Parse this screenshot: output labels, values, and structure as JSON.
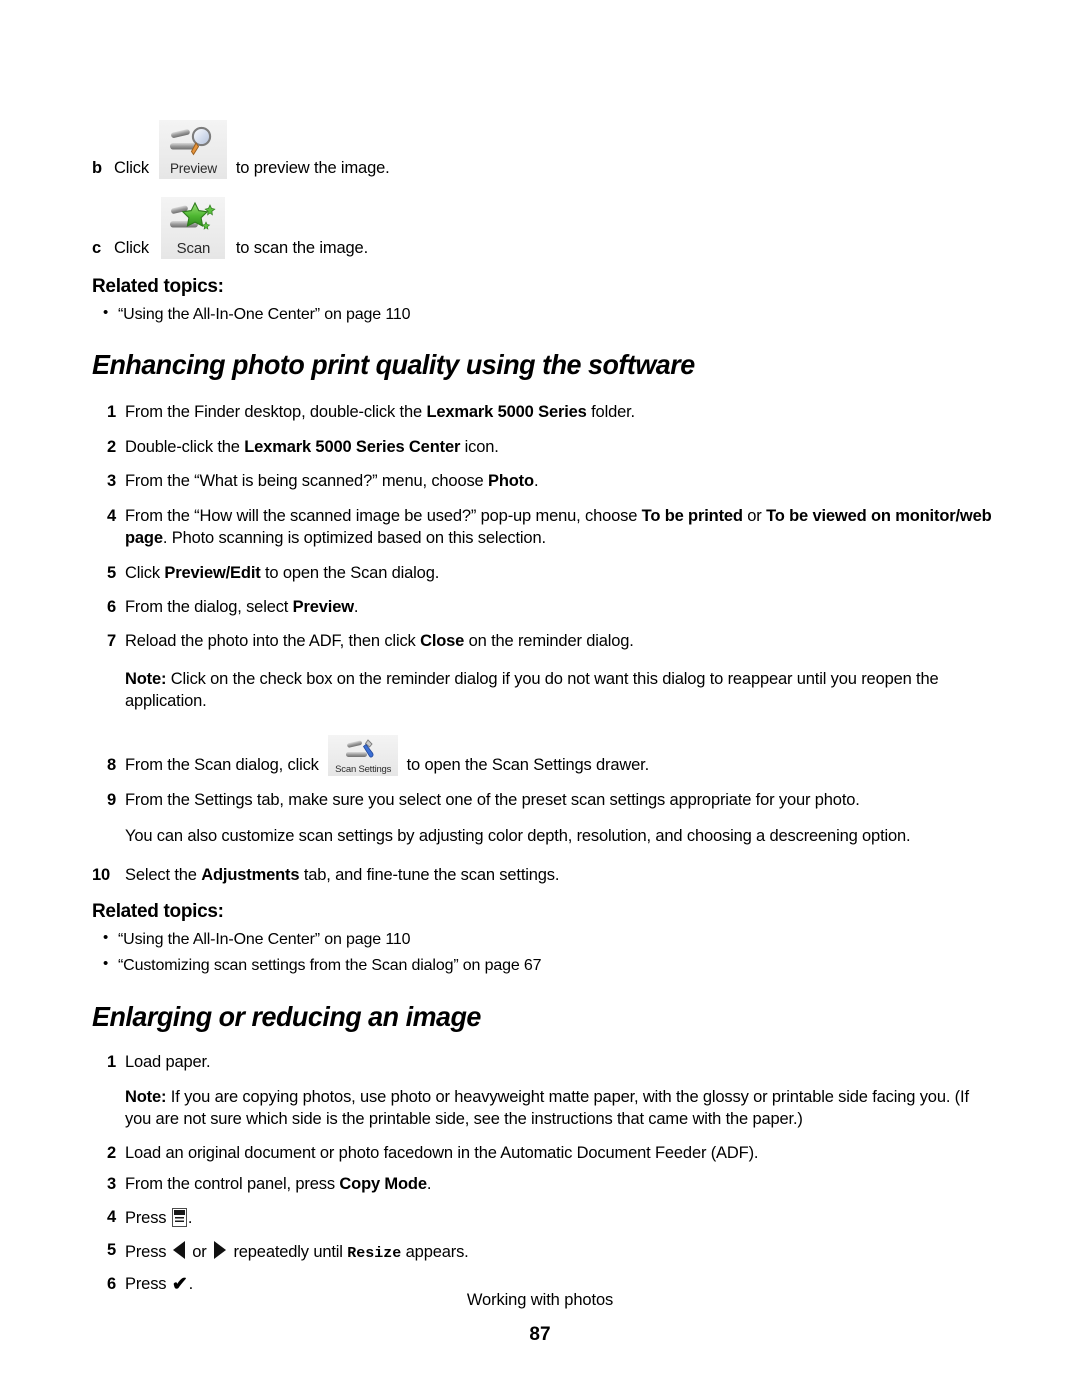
{
  "document": {
    "page_number": "87",
    "footer_title": "Working with photos"
  },
  "substeps": [
    {
      "marker": "b",
      "lead": "Click ",
      "button": "Preview",
      "tail": " to preview the image."
    },
    {
      "marker": "c",
      "lead": "Click ",
      "button": "Scan",
      "tail": " to scan the image."
    }
  ],
  "related_topics_1": {
    "heading": "Related topics:",
    "items": [
      "“Using the All-In-One Center” on page 110"
    ]
  },
  "section_enhancing": {
    "heading": "Enhancing photo print quality using the software",
    "steps": [
      {
        "num": "1",
        "parts": [
          {
            "t": "From the Finder desktop, double-click the ",
            "b": false
          },
          {
            "t": "Lexmark 5000 Series",
            "b": true
          },
          {
            "t": " folder.",
            "b": false
          }
        ]
      },
      {
        "num": "2",
        "parts": [
          {
            "t": "Double-click the ",
            "b": false
          },
          {
            "t": "Lexmark 5000 Series Center",
            "b": true
          },
          {
            "t": " icon.",
            "b": false
          }
        ]
      },
      {
        "num": "3",
        "parts": [
          {
            "t": "From the “What is being scanned?” menu, choose ",
            "b": false
          },
          {
            "t": "Photo",
            "b": true
          },
          {
            "t": ".",
            "b": false
          }
        ]
      },
      {
        "num": "4",
        "parts": [
          {
            "t": "From the “How will the scanned image be used?” pop-up menu, choose ",
            "b": false
          },
          {
            "t": "To be printed",
            "b": true
          },
          {
            "t": " or ",
            "b": false
          },
          {
            "t": "To be viewed on monitor/web page",
            "b": true
          },
          {
            "t": ". Photo scanning is optimized based on this selection.",
            "b": false
          }
        ]
      },
      {
        "num": "5",
        "parts": [
          {
            "t": "Click ",
            "b": false
          },
          {
            "t": "Preview/Edit",
            "b": true
          },
          {
            "t": " to open the Scan dialog.",
            "b": false
          }
        ]
      },
      {
        "num": "6",
        "parts": [
          {
            "t": "From the dialog, select ",
            "b": false
          },
          {
            "t": "Preview",
            "b": true
          },
          {
            "t": ".",
            "b": false
          }
        ]
      },
      {
        "num": "7",
        "parts": [
          {
            "t": "Reload the photo into the ADF, then click ",
            "b": false
          },
          {
            "t": "Close",
            "b": true
          },
          {
            "t": " on the reminder dialog.",
            "b": false
          }
        ]
      }
    ],
    "note_label": "Note:",
    "note_text": " Click on the check box on the reminder dialog if you do not want this dialog to reappear until you reopen the application.",
    "step8": {
      "num": "8",
      "lead": "From the Scan dialog, click ",
      "button": "Scan Settings",
      "tail": " to open the Scan Settings drawer."
    },
    "step9": {
      "num": "9",
      "text": "From the Settings tab, make sure you select one of the preset scan settings appropriate for your photo."
    },
    "step9_extra": "You can also customize scan settings by adjusting color depth, resolution, and choosing a descreening option.",
    "step10": {
      "num": "10",
      "parts": [
        {
          "t": "Select the ",
          "b": false
        },
        {
          "t": "Adjustments",
          "b": true
        },
        {
          "t": " tab, and fine-tune the scan settings.",
          "b": false
        }
      ]
    }
  },
  "related_topics_2": {
    "heading": "Related topics:",
    "items": [
      "“Using the All-In-One Center” on page 110",
      "“Customizing scan settings from the Scan dialog” on page 67"
    ]
  },
  "section_enlarging": {
    "heading": "Enlarging or reducing an image",
    "step1": {
      "num": "1",
      "text": "Load paper."
    },
    "note_label": "Note:",
    "note_text": " If you are copying photos, use photo or heavyweight matte paper, with the glossy or printable side facing you. (If you are not sure which side is the printable side, see the instructions that came with the paper.)",
    "step2": {
      "num": "2",
      "text": "Load an original document or photo facedown in the Automatic Document Feeder (ADF)."
    },
    "step3": {
      "num": "3",
      "parts": [
        {
          "t": "From the control panel, press ",
          "b": false
        },
        {
          "t": "Copy Mode",
          "b": true
        },
        {
          "t": ".",
          "b": false
        }
      ]
    },
    "step4": {
      "num": "4",
      "lead": "Press ",
      "tail": "."
    },
    "step5": {
      "num": "5",
      "lead": "Press ",
      "mid": " or ",
      "after_arrows": " repeatedly until ",
      "mono": "Resize",
      "tail": " appears."
    },
    "step6": {
      "num": "6",
      "lead": "Press ",
      "check": "✔",
      "tail": "."
    }
  },
  "icons": {
    "preview_button": "preview-magnifier-icon",
    "scan_button": "scan-star-wand-icon",
    "scan_settings_button": "scan-settings-wrench-icon",
    "menu_button": "control-panel-menu-icon",
    "left_arrow": "left-arrow-icon",
    "right_arrow": "right-arrow-icon",
    "select_check": "check-select-icon"
  },
  "colors": {
    "text": "#000000",
    "button_face": "#ececec",
    "scan_star": "#5cc23f",
    "magnifier_glass": "#cdd7ea",
    "wrench_blue": "#3b6fd4"
  }
}
